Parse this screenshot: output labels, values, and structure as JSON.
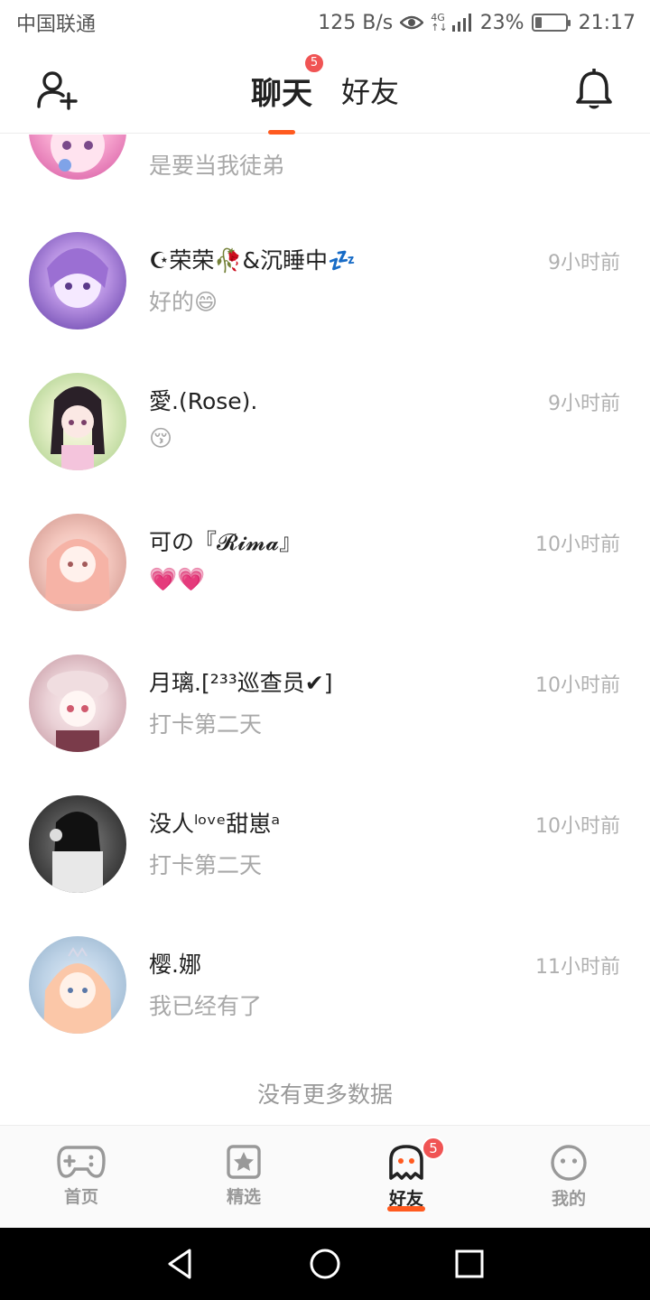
{
  "status_bar": {
    "carrier": "中国联通",
    "speed": "125 B/s",
    "network_top": "4G",
    "network_bottom": "↑↓",
    "battery_text": "23%",
    "battery_level": 0.23,
    "time": "21:17"
  },
  "header": {
    "tabs": [
      {
        "label": "聊天",
        "badge": "5",
        "active": true
      },
      {
        "label": "好友",
        "active": false
      }
    ],
    "left_icon": "add-friend-icon",
    "right_icon": "bell-icon"
  },
  "chats": [
    {
      "name": "",
      "message": "是要当我徒弟",
      "time": ""
    },
    {
      "name": "☪荣荣🥀&沉睡中💤",
      "message": "好的😄",
      "time": "9小时前"
    },
    {
      "name": "愛.(Rose).",
      "message": "😚",
      "time": "9小时前"
    },
    {
      "name": "可の『𝓡𝓲𝓶𝓪』",
      "message": "💗💗",
      "time": "10小时前"
    },
    {
      "name": "月璃.[²³³巡查员✔]",
      "message": "打卡第二天",
      "time": "10小时前"
    },
    {
      "name": "没人ˡᵒᵛᵉ甜崽ᵃ",
      "message": "打卡第二天",
      "time": "10小时前"
    },
    {
      "name": "樱.娜",
      "message": "我已经有了",
      "time": "11小时前"
    }
  ],
  "no_more": "没有更多数据",
  "bottom_nav": [
    {
      "label": "首页",
      "icon": "gamepad-icon",
      "active": false
    },
    {
      "label": "精选",
      "icon": "star-bookmark-icon",
      "active": false
    },
    {
      "label": "好友",
      "icon": "ghost-icon",
      "active": true,
      "badge": "5"
    },
    {
      "label": "我的",
      "icon": "smiley-icon",
      "active": false
    }
  ],
  "colors": {
    "accent": "#ff5a1f",
    "badge": "#f05454"
  }
}
